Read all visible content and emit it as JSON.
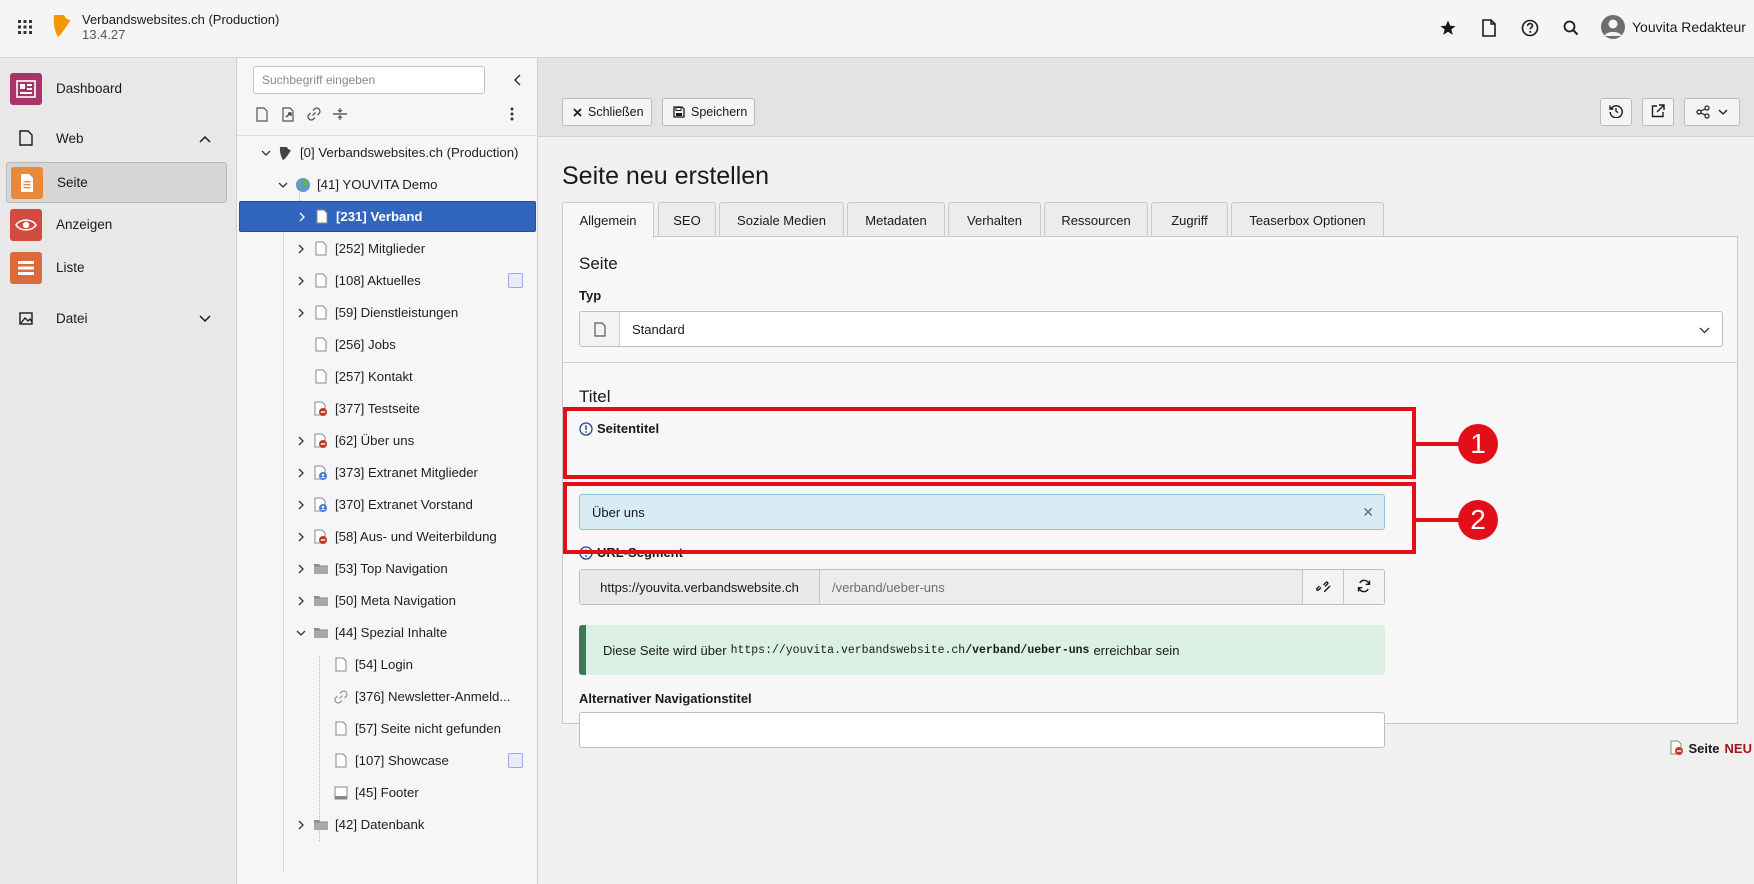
{
  "topbar": {
    "site_name": "Verbandswebsites.ch (Production)",
    "version": "13.4.27",
    "user_name": "Youvita Redakteur",
    "accent": "#f49700"
  },
  "modules": {
    "dashboard": "Dashboard",
    "web": "Web",
    "seite": "Seite",
    "anzeigen": "Anzeigen",
    "liste": "Liste",
    "datei": "Datei"
  },
  "tree": {
    "search_placeholder": "Suchbegriff eingeben",
    "nodes": [
      {
        "label": "[0] Verbandswebsites.ch (Production)",
        "icon": "typo3-icon"
      },
      {
        "label": "[41] YOUVITA Demo",
        "icon": "globe-icon"
      },
      {
        "label": "[231] Verband",
        "icon": "page-icon"
      },
      {
        "label": "[252] Mitglieder",
        "icon": "page-icon"
      },
      {
        "label": "[108] Aktuelles",
        "icon": "page-icon"
      },
      {
        "label": "[59] Dienstleistungen",
        "icon": "page-icon"
      },
      {
        "label": "[256] Jobs",
        "icon": "page-icon"
      },
      {
        "label": "[257] Kontakt",
        "icon": "page-icon"
      },
      {
        "label": "[377] Testseite",
        "icon": "page-hidden-icon"
      },
      {
        "label": "[62] Über uns",
        "icon": "page-hidden-icon"
      },
      {
        "label": "[373] Extranet Mitglieder",
        "icon": "page-restricted-icon"
      },
      {
        "label": "[370] Extranet Vorstand",
        "icon": "page-restricted-icon"
      },
      {
        "label": "[58] Aus- und Weiterbildung",
        "icon": "page-hidden-icon"
      },
      {
        "label": "[53] Top Navigation",
        "icon": "folder-icon"
      },
      {
        "label": "[50] Meta Navigation",
        "icon": "folder-icon"
      },
      {
        "label": "[44] Spezial Inhalte",
        "icon": "folder-icon"
      },
      {
        "label": "[54] Login",
        "icon": "page-icon"
      },
      {
        "label": "[376] Newsletter-Anmeld...",
        "icon": "link-icon"
      },
      {
        "label": "[57] Seite nicht gefunden",
        "icon": "page-icon"
      },
      {
        "label": "[107] Showcase",
        "icon": "page-icon"
      },
      {
        "label": "[45] Footer",
        "icon": "footer-page-icon"
      },
      {
        "label": "[42] Datenbank",
        "icon": "folder-icon"
      }
    ]
  },
  "docheader": {
    "close_label": "Schließen",
    "save_label": "Speichern"
  },
  "form": {
    "title": "Seite neu erstellen",
    "tabs": [
      "Allgemein",
      "SEO",
      "Soziale Medien",
      "Metadaten",
      "Verhalten",
      "Ressourcen",
      "Zugriff",
      "Teaserbox Optionen"
    ],
    "section_seite": "Seite",
    "typ_label": "Typ",
    "typ_value": "Standard",
    "section_titel": "Titel",
    "seitentitel_label": "Seitentitel",
    "seitentitel_value": "Über uns",
    "url_label": "URL-Segment",
    "url_prefix": "https://youvita.verbandswebsite.ch",
    "url_placeholder": "/verband/ueber-uns",
    "info_before": "Diese Seite wird über",
    "info_url_base": "https://youvita.verbandswebsite.ch",
    "info_url_path": "/verband/ueber-uns",
    "info_after": "erreichbar sein",
    "alt_nav_label": "Alternativer Navigationstitel",
    "alt_nav_value": "",
    "state_label": "Seite",
    "state_badge": "NEU"
  },
  "annotations": {
    "marker_1": "1",
    "marker_2": "2",
    "color": "#e20f1a"
  }
}
